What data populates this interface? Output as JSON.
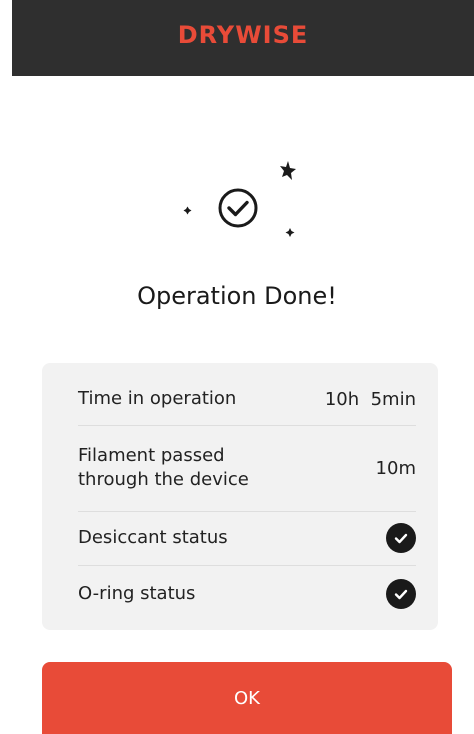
{
  "header": {
    "brand": "DRYWISE",
    "brand_color": "#e84b38",
    "background_color": "#2f2f2f"
  },
  "status": {
    "icon": "check-circle-icon",
    "title": "Operation Done!"
  },
  "summary": {
    "rows": [
      {
        "label": "Time in operation",
        "value": "10h  5min"
      },
      {
        "label": "Filament passed\nthrough the device",
        "value": "10m"
      },
      {
        "label": "Desiccant status",
        "value_icon": "check-badge-icon"
      },
      {
        "label": "O-ring status",
        "value_icon": "check-badge-icon"
      }
    ]
  },
  "actions": {
    "ok_label": "OK",
    "ok_color": "#e84b38"
  }
}
